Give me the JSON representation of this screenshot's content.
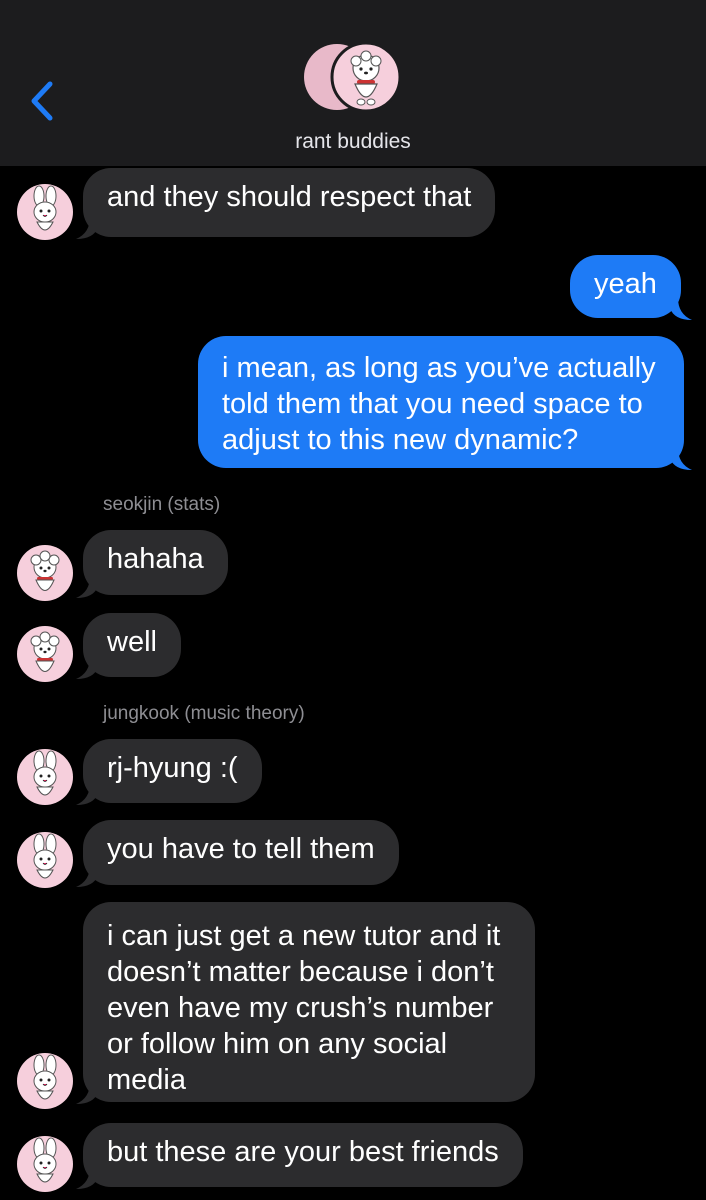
{
  "header": {
    "group_name": "rant buddies",
    "back_icon": "chevron-left-icon",
    "accent_color": "#1e7bf6"
  },
  "messages": [
    {
      "direction": "incoming",
      "text": "and they should respect that",
      "avatar": "cooky"
    },
    {
      "direction": "outgoing",
      "text": "yeah"
    },
    {
      "direction": "outgoing",
      "text": "i mean, as long as you’ve actually\ntold them that you need space to\nadjust to this new dynamic?"
    },
    {
      "sender": "seokjin (stats)"
    },
    {
      "direction": "incoming",
      "text": "hahaha",
      "avatar": "rj"
    },
    {
      "direction": "incoming",
      "text": "well",
      "avatar": "rj"
    },
    {
      "sender": "jungkook (music theory)"
    },
    {
      "direction": "incoming",
      "text": "rj-hyung :(",
      "avatar": "cooky"
    },
    {
      "direction": "incoming",
      "text": "you have to tell them",
      "avatar": "cooky"
    },
    {
      "direction": "incoming",
      "text": "i can just get a new tutor and it\ndoesn’t matter because i don’t\neven have my crush’s number\nor follow him on any social\nmedia",
      "avatar": "cooky"
    },
    {
      "direction": "incoming",
      "text": "but these are your best friends",
      "avatar": "cooky"
    }
  ],
  "colors": {
    "incoming_bubble": "#2c2c2e",
    "outgoing_bubble": "#1e7bf6",
    "header_bg": "#1c1c1e",
    "avatar_bg": "#f6cfdc"
  }
}
